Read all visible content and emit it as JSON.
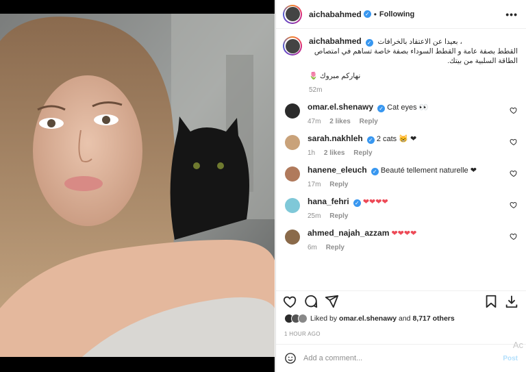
{
  "post": {
    "author": "aichabahmed",
    "follow_status": "Following",
    "more_icon": "more-options-icon"
  },
  "caption": {
    "lines": [
      "بعيدا عن الاعتقاد بالخرافات ،",
      "القطط بصفة عامة و القطط السوداء بصفة خاصة تساهم في امتصاص",
      "الطاقة السلبية من بيتك."
    ],
    "greeting": "نهاركم مبروك 🌷",
    "time": "52m"
  },
  "comments": [
    {
      "user": "omar.el.shenawy",
      "text": "Cat eyes 👀",
      "time": "47m",
      "likes": "2 likes",
      "reply": "Reply",
      "avatar_color": "#2b2b2b"
    },
    {
      "user": "sarah.nakhleh",
      "text": "2 cats 😸 ❤",
      "time": "1h",
      "likes": "2 likes",
      "reply": "Reply",
      "avatar_color": "#c9a27a"
    },
    {
      "user": "hanene_eleuch",
      "text": "Beauté tellement naturelle ❤",
      "time": "17m",
      "likes": "",
      "reply": "Reply",
      "avatar_color": "#b07a5c"
    },
    {
      "user": "hana_fehri",
      "text": "❤❤❤❤",
      "time": "25m",
      "likes": "",
      "reply": "Reply",
      "avatar_color": "#7fc8d8"
    },
    {
      "user": "ahmed_najah_azzam",
      "text": "❤❤❤❤",
      "time": "6m",
      "likes": "",
      "reply": "Reply",
      "avatar_color": "#8a6a4a"
    }
  ],
  "liked_by": {
    "prefix": "Liked by",
    "user": "omar.el.shenawy",
    "joiner": "and",
    "count": "8,717 others"
  },
  "timestamp": "1 HOUR AGO",
  "add_comment": {
    "placeholder": "Add a comment...",
    "post_label": "Post"
  },
  "watermark": "Ac",
  "colors": {
    "verified": "#3897f0",
    "heart": "#ed4956",
    "post_button": "#b2dffc"
  }
}
